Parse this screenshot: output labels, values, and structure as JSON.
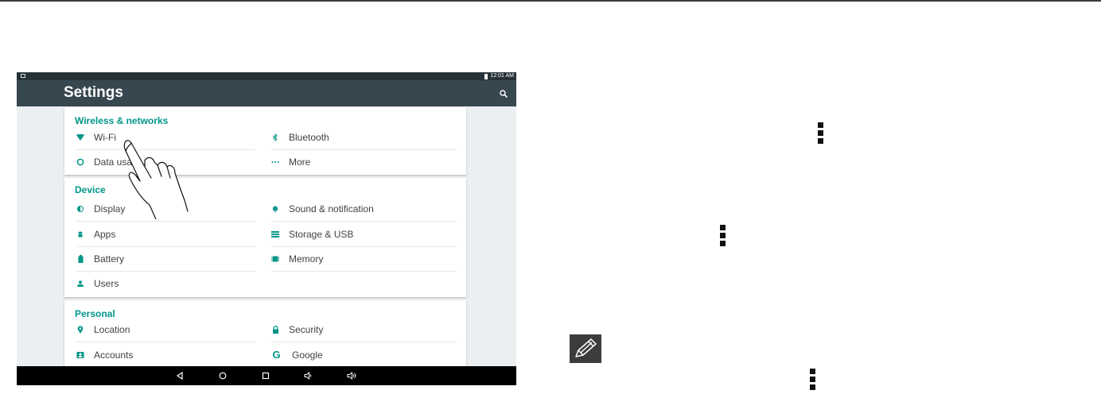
{
  "statusbar": {
    "time": "12:01 AM"
  },
  "appbar": {
    "title": "Settings"
  },
  "sections": {
    "wireless": {
      "title": "Wireless & networks",
      "items": {
        "wifi": "Wi-Fi",
        "bluetooth": "Bluetooth",
        "data_usage": "Data usage",
        "more": "More"
      }
    },
    "device": {
      "title": "Device",
      "items": {
        "display": "Display",
        "sound": "Sound & notification",
        "apps": "Apps",
        "storage": "Storage & USB",
        "battery": "Battery",
        "memory": "Memory",
        "users": "Users"
      }
    },
    "personal": {
      "title": "Personal",
      "items": {
        "location": "Location",
        "security": "Security",
        "accounts": "Accounts",
        "google": "Google"
      }
    }
  },
  "colors": {
    "accent": "#009688",
    "appbar": "#37474f",
    "statusbar": "#263238",
    "background": "#eceff1"
  }
}
